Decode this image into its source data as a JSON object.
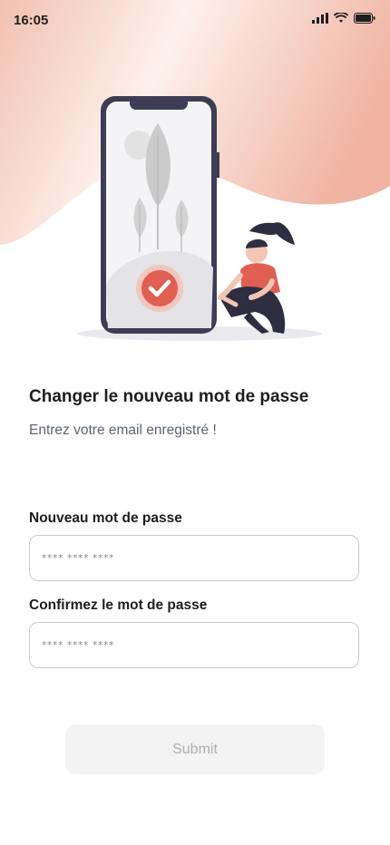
{
  "status_bar": {
    "time": "16:05",
    "icons": [
      "signal-icon",
      "wifi-icon",
      "battery-icon"
    ]
  },
  "illustration": {
    "icons": [
      "phone-illustration",
      "check-icon",
      "person-illustration"
    ],
    "colors": {
      "accent": "#e05f52",
      "phone_frame": "#3f3d56",
      "plant": "#cccccc"
    }
  },
  "page": {
    "title": "Changer le nouveau mot de passe",
    "subtitle": "Entrez votre email enregistré !"
  },
  "form": {
    "new_password": {
      "label": "Nouveau mot de passe",
      "placeholder": "**** **** ****"
    },
    "confirm_password": {
      "label": "Confirmez le mot de passe",
      "placeholder": "**** **** ****"
    },
    "submit_label": "Submit"
  },
  "colors": {
    "header_gradient": [
      "#fbe8e1",
      "#f2b9a8"
    ],
    "button_bg": "#f3f3f4",
    "button_text": "#aeaeb2"
  }
}
